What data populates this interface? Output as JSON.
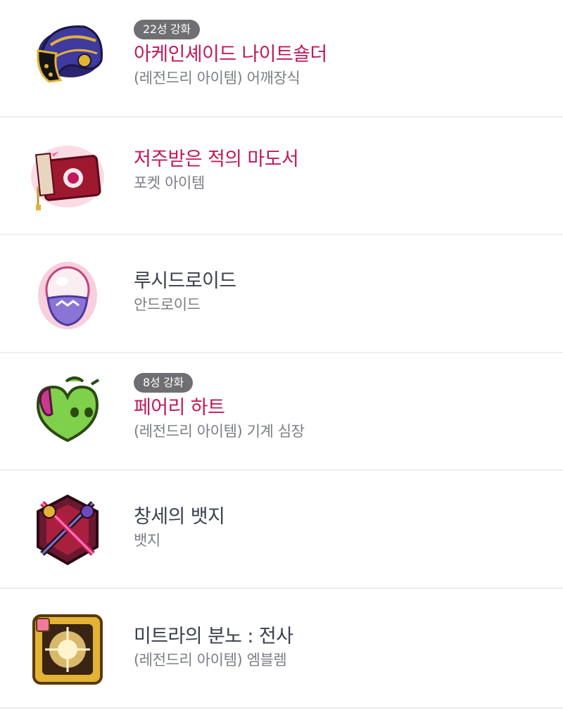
{
  "items": [
    {
      "badge": "22성 강화",
      "name": "아케인셰이드 나이트숄더",
      "sub": "(레전드리 아이템) 어깨장식",
      "icon": "shoulder-icon",
      "name_color": "#c2185b"
    },
    {
      "badge": "",
      "name": "저주받은 적의 마도서",
      "sub": "포켓 아이템",
      "icon": "spellbook-icon",
      "name_color": "#c2185b"
    },
    {
      "badge": "",
      "name": "루시드로이드",
      "sub": "안드로이드",
      "icon": "android-egg-icon",
      "name_color": "#3a3f4d"
    },
    {
      "badge": "8성 강화",
      "name": "페어리 하트",
      "sub": "(레전드리 아이템) 기계 심장",
      "icon": "fairy-heart-icon",
      "name_color": "#c2185b"
    },
    {
      "badge": "",
      "name": "창세의 뱃지",
      "sub": "뱃지",
      "icon": "genesis-badge-icon",
      "name_color": "#3a3f4d"
    },
    {
      "badge": "",
      "name": "미트라의 분노 : 전사",
      "sub": "(레전드리 아이템) 엠블렘",
      "icon": "emblem-icon",
      "name_color": "#3a3f4d"
    }
  ]
}
